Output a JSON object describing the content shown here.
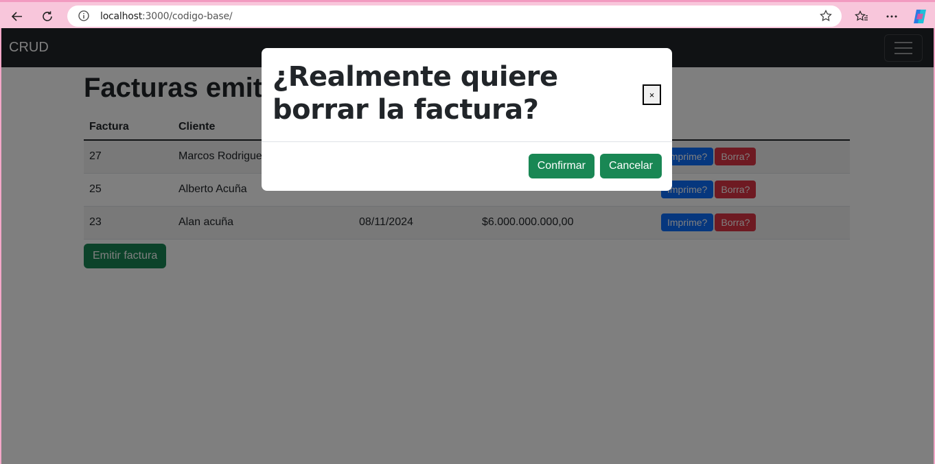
{
  "browser": {
    "url_host": "localhost",
    "url_rest": ":3000/codigo-base/"
  },
  "navbar": {
    "brand": "CRUD"
  },
  "page": {
    "title": "Facturas emitidas",
    "columns": [
      "Factura",
      "Cliente",
      "",
      "",
      ""
    ],
    "rows": [
      {
        "factura": "27",
        "cliente": "Marcos Rodriguez",
        "fecha": "",
        "total": ""
      },
      {
        "factura": "25",
        "cliente": "Alberto Acuña",
        "fecha": "",
        "total": ""
      },
      {
        "factura": "23",
        "cliente": "Alan acuña",
        "fecha": "08/11/2024",
        "total": "$6.000.000.000,00"
      }
    ],
    "print_label": "Imprime?",
    "delete_label": "Borra?",
    "emit_label": "Emitir factura"
  },
  "modal": {
    "title": "¿Realmente quiere borrar la factura?",
    "close_label": "×",
    "confirm_label": "Confirmar",
    "cancel_label": "Cancelar"
  },
  "colors": {
    "navbar": "#212529",
    "primary": "#0d6efd",
    "danger": "#dc3545",
    "success": "#198754",
    "browser_frame": "#f8c6db"
  }
}
